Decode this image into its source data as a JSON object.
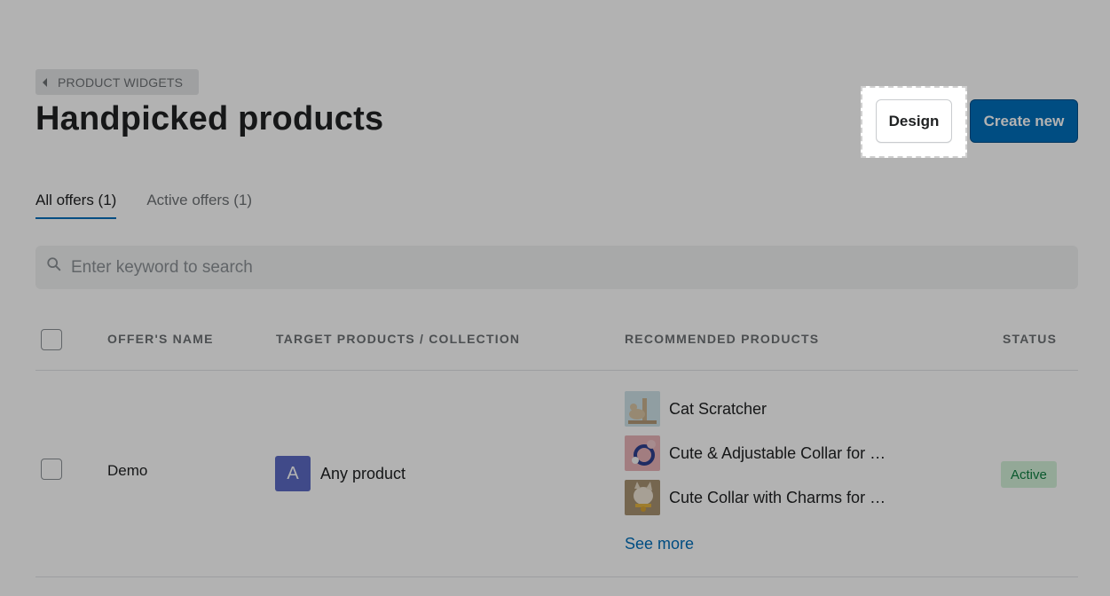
{
  "breadcrumb": {
    "label": "PRODUCT WIDGETS"
  },
  "header": {
    "title": "Handpicked products",
    "design_label": "Design",
    "create_label": "Create new"
  },
  "tabs": [
    {
      "label": "All offers (1)",
      "active": true
    },
    {
      "label": "Active offers (1)",
      "active": false
    }
  ],
  "search": {
    "placeholder": "Enter keyword to search",
    "value": ""
  },
  "table": {
    "columns": [
      "OFFER'S NAME",
      "TARGET PRODUCTS / COLLECTION",
      "RECOMMENDED PRODUCTS",
      "STATUS"
    ],
    "rows": [
      {
        "name": "Demo",
        "target": {
          "avatar_letter": "A",
          "label": "Any product"
        },
        "recommended": [
          {
            "label": "Cat Scratcher"
          },
          {
            "label": "Cute & Adjustable Collar for C…"
          },
          {
            "label": "Cute Collar with Charms for C…"
          }
        ],
        "see_more": "See more",
        "status": "Active"
      }
    ]
  },
  "colors": {
    "primary": "#006fbb",
    "avatar": "#5c6ac4",
    "status_bg": "#d3f1d8",
    "status_text": "#108043"
  }
}
